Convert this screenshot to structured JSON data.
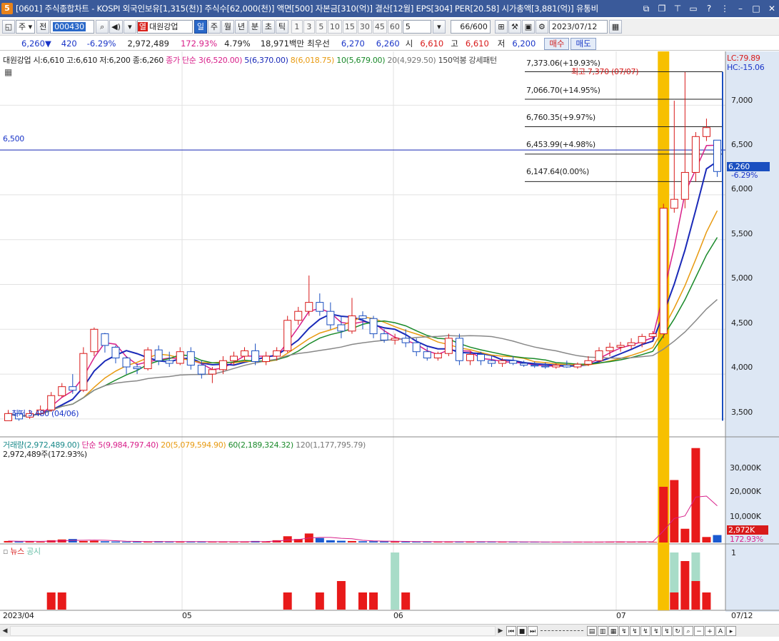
{
  "window": {
    "app_number": "5",
    "title": "[0601] 주식종합차트 - KOSPI 외국인보유[1,315(천)] 주식수[62,000(천)] 액면[500] 자본금[310(억)] 결산[12월] EPS[304] PER[20.58] 시가총액[3,881(억)] 유통비"
  },
  "toolbar": {
    "period_select": "주",
    "jeon_label": "전",
    "code": "000430",
    "yeol_label": "열",
    "stock_name": "대원강업",
    "periods": [
      "일",
      "주",
      "월",
      "년",
      "분",
      "초",
      "틱"
    ],
    "active_period": "일",
    "intervals": [
      "1",
      "3",
      "5",
      "10",
      "15",
      "30",
      "45",
      "60"
    ],
    "interval_value": "5",
    "count_display": "66/600",
    "date": "2023/07/12"
  },
  "quote": {
    "price": "6,260",
    "change": "420",
    "change_pct": "-6.29%",
    "volume": "2,972,489",
    "volume_ratio": "172.93%",
    "turnover": "4.79%",
    "amount": "18,971백만",
    "best_label": "최우선",
    "ask": "6,270",
    "bid": "6,260",
    "open_label": "시",
    "open": "6,610",
    "high_label": "고",
    "high": "6,610",
    "low_label": "저",
    "low": "6,200",
    "buy_label": "매수",
    "sell_label": "매도"
  },
  "legend": {
    "stock_info": "대원강업 시:6,610 고:6,610 저:6,200 종:6,260",
    "ma_title": "종가 단순 3(6,520.00)",
    "ma5": "5(6,370.00)",
    "ma8": "8(6,018.75)",
    "ma10": "10(5,679.00)",
    "ma20": "20(4,929.50)",
    "overlay": "150억봉 강세패턴",
    "volume_title": "거래량(2,972,489.00)",
    "vol_ma_title": "단순 5(9,984,797.40)",
    "vol_ma20": "20(5,079,594.90)",
    "vol_ma60": "60(2,189,324.32)",
    "vol_ma120": "120(1,177,795.79)",
    "volume_sub": "2,972,489주(172.93%)",
    "news_label": "뉴스",
    "disclosure_label": "공시"
  },
  "right_panel": {
    "lc": "LC:79.89",
    "hc": "HC:-15.06",
    "price_tag": "6,260",
    "price_tag_pct": "-6.29%",
    "vol_tag": "2,972K",
    "vol_tag_pct": "172.93%"
  },
  "annotations": {
    "h_line_label": "6,500",
    "high_label": "최고 7,370 (07/07)",
    "low_label": "최저 3,480 (04/06)",
    "fib_levels": [
      "7,373.06(+19.93%)",
      "7,066.70(+14.95%)",
      "6,760.35(+9.97%)",
      "6,453.99(+4.98%)",
      "6,147.64(0.00%)"
    ]
  },
  "axis": {
    "price_ticks": [
      "7,000",
      "6,500",
      "6,000",
      "5,500",
      "5,000",
      "4,500",
      "4,000",
      "3,500"
    ],
    "volume_ticks": [
      "30,000K",
      "20,000K",
      "10,000K"
    ],
    "news_tick": "1",
    "date_ticks": [
      "2023/04",
      "05",
      "06",
      "07",
      "07/12"
    ]
  },
  "chart_data": {
    "type": "candlestick",
    "price_range": [
      3300,
      7600
    ],
    "ohlc": [
      [
        3480,
        3600,
        3480,
        3560
      ],
      [
        3560,
        3600,
        3480,
        3500
      ],
      [
        3520,
        3600,
        3500,
        3560
      ],
      [
        3560,
        3650,
        3540,
        3600
      ],
      [
        3600,
        3800,
        3580,
        3760
      ],
      [
        3760,
        3900,
        3740,
        3860
      ],
      [
        3860,
        4000,
        3780,
        3820
      ],
      [
        3820,
        4300,
        3800,
        4230
      ],
      [
        4250,
        4520,
        4200,
        4500
      ],
      [
        4450,
        4460,
        4240,
        4320
      ],
      [
        4300,
        4320,
        4120,
        4180
      ],
      [
        4180,
        4200,
        4000,
        4080
      ],
      [
        4080,
        4120,
        4000,
        4060
      ],
      [
        4060,
        4300,
        4040,
        4270
      ],
      [
        4270,
        4320,
        4100,
        4150
      ],
      [
        4150,
        4250,
        4080,
        4120
      ],
      [
        4120,
        4300,
        4100,
        4250
      ],
      [
        4250,
        4300,
        4050,
        4100
      ],
      [
        4100,
        4150,
        3950,
        4000
      ],
      [
        4000,
        4080,
        3900,
        4050
      ],
      [
        4050,
        4200,
        4000,
        4150
      ],
      [
        4150,
        4250,
        4100,
        4200
      ],
      [
        4200,
        4300,
        4150,
        4260
      ],
      [
        4260,
        4340,
        4100,
        4140
      ],
      [
        4140,
        4250,
        4100,
        4200
      ],
      [
        4200,
        4300,
        4150,
        4260
      ],
      [
        4260,
        4650,
        4240,
        4600
      ],
      [
        4600,
        4750,
        4550,
        4700
      ],
      [
        4700,
        5100,
        4650,
        4800
      ],
      [
        4800,
        4900,
        4650,
        4700
      ],
      [
        4700,
        4800,
        4500,
        4550
      ],
      [
        4550,
        4650,
        4400,
        4480
      ],
      [
        4480,
        4850,
        4450,
        4650
      ],
      [
        4650,
        4700,
        4500,
        4620
      ],
      [
        4620,
        4650,
        4400,
        4450
      ],
      [
        4450,
        4500,
        4350,
        4380
      ],
      [
        4380,
        4450,
        4330,
        4400
      ],
      [
        4400,
        4500,
        4300,
        4350
      ],
      [
        4350,
        4400,
        4200,
        4250
      ],
      [
        4250,
        4300,
        4150,
        4180
      ],
      [
        4180,
        4250,
        4150,
        4230
      ],
      [
        4230,
        4450,
        4200,
        4400
      ],
      [
        4400,
        4450,
        4100,
        4150
      ],
      [
        4150,
        4250,
        4100,
        4220
      ],
      [
        4220,
        4250,
        4100,
        4150
      ],
      [
        4150,
        4200,
        4080,
        4120
      ],
      [
        4120,
        4180,
        4080,
        4150
      ],
      [
        4150,
        4200,
        4100,
        4120
      ],
      [
        4120,
        4150,
        4080,
        4100
      ],
      [
        4100,
        4140,
        4070,
        4090
      ],
      [
        4090,
        4130,
        4060,
        4080
      ],
      [
        4080,
        4120,
        4060,
        4100
      ],
      [
        4100,
        4150,
        4070,
        4080
      ],
      [
        4080,
        4130,
        4060,
        4110
      ],
      [
        4110,
        4200,
        4090,
        4150
      ],
      [
        4150,
        4300,
        4130,
        4260
      ],
      [
        4260,
        4350,
        4200,
        4300
      ],
      [
        4300,
        4360,
        4250,
        4320
      ],
      [
        4320,
        4400,
        4280,
        4350
      ],
      [
        4350,
        4450,
        4300,
        4420
      ],
      [
        4420,
        4480,
        4380,
        4450
      ],
      [
        4450,
        5900,
        4400,
        5850
      ],
      [
        5850,
        7050,
        5800,
        5950
      ],
      [
        5950,
        7370,
        5850,
        6250
      ],
      [
        6250,
        6700,
        6150,
        6650
      ],
      [
        6650,
        6850,
        6600,
        6750
      ],
      [
        6610,
        6610,
        6200,
        6260
      ]
    ],
    "volume_k": [
      600,
      400,
      500,
      300,
      900,
      1200,
      1400,
      600,
      700,
      500,
      400,
      300,
      300,
      400,
      500,
      300,
      300,
      400,
      300,
      250,
      300,
      350,
      400,
      600,
      400,
      900,
      2500,
      1400,
      3600,
      1800,
      900,
      700,
      600,
      500,
      500,
      400,
      400,
      300,
      300,
      300,
      300,
      400,
      300,
      300,
      300,
      250,
      300,
      250,
      250,
      200,
      200,
      200,
      200,
      300,
      250,
      250,
      300,
      300,
      250,
      300,
      250,
      22300,
      25000,
      5500,
      37800,
      2200,
      2972
    ],
    "news": [
      0,
      0,
      0,
      0,
      0.3,
      0.3,
      0,
      0,
      0,
      0,
      0,
      0,
      0,
      0,
      0,
      0,
      0,
      0,
      0,
      0,
      0,
      0,
      0,
      0,
      0,
      0,
      0.3,
      0,
      0,
      0.3,
      0,
      0.5,
      0,
      0.3,
      0.3,
      0,
      0,
      0.3,
      0,
      0,
      0,
      0,
      0,
      0,
      0,
      0,
      0,
      0,
      0,
      0,
      0,
      0,
      0,
      0,
      0,
      0,
      0,
      0,
      0,
      0,
      0,
      0,
      0.3,
      0.85,
      0.5,
      0.3
    ],
    "disclosure": [
      0,
      0,
      0,
      0,
      0,
      0,
      0,
      0,
      0,
      0,
      0,
      0,
      0,
      0,
      0,
      0,
      0,
      0,
      0,
      0,
      0,
      0,
      0,
      0,
      0,
      0,
      0,
      0,
      0,
      0,
      0,
      0,
      0,
      0,
      0,
      0,
      1,
      0,
      0,
      0,
      0,
      0,
      0,
      0,
      0,
      0,
      0,
      0,
      0,
      0,
      0,
      0,
      0,
      0,
      0,
      0,
      0,
      0,
      0,
      0,
      0,
      0,
      1,
      0,
      1,
      0,
      0
    ]
  }
}
